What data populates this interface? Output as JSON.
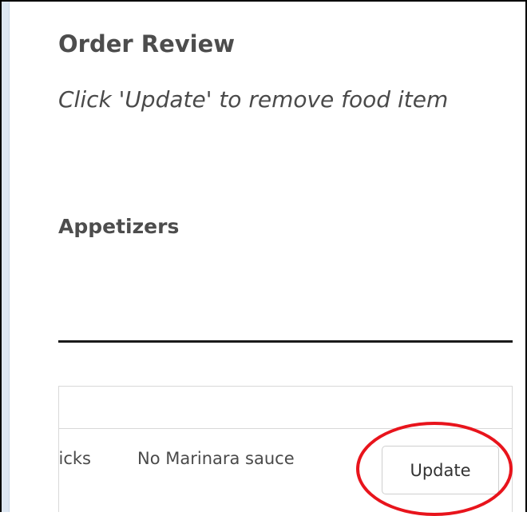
{
  "page": {
    "title": "Order Review",
    "instructions": "Click 'Update' to remove food item"
  },
  "section": {
    "title": "Appetizers"
  },
  "order_items": [
    {
      "name": "Mozzarella Sticks",
      "note": "No Marinara sauce",
      "action_label": "Update"
    }
  ],
  "annotation": {
    "shape": "ellipse",
    "color": "#e8141c",
    "target": "update-button"
  },
  "colors": {
    "frame": "#000000",
    "left_strip": "#dde7f3",
    "text": "#4a4a4a",
    "divider": "#1a1a1a",
    "table_border": "#d9d9d9"
  }
}
